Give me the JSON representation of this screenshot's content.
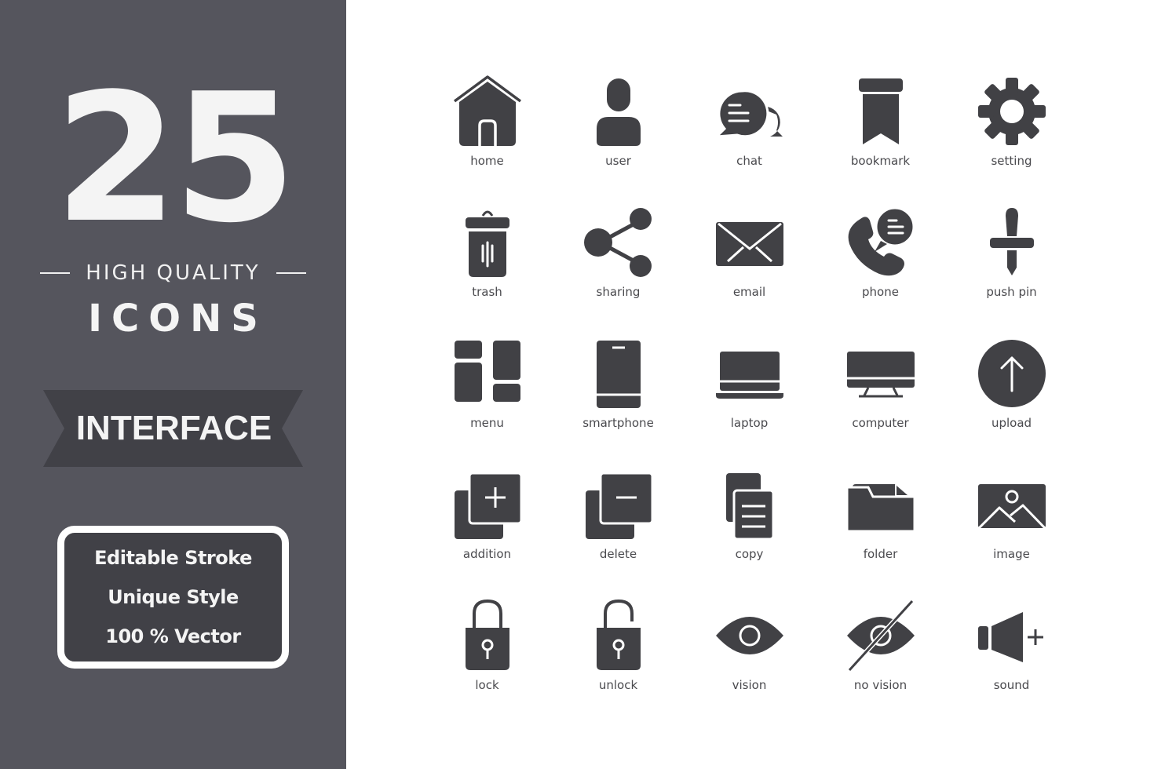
{
  "banner": {
    "count": "25",
    "subtitle": "HIGH QUALITY",
    "title": "ICONS",
    "category": "INTERFACE",
    "features": [
      "Editable Stroke",
      "Unique Style",
      "100 % Vector"
    ]
  },
  "colors": {
    "sidebar_bg": "#55555d",
    "ribbon_bg": "#414147",
    "icon_fill": "#414145",
    "text_light": "#f4f4f4",
    "label_text": "#4a4a4e"
  },
  "icons": [
    {
      "label": "home",
      "icon": "home-icon"
    },
    {
      "label": "user",
      "icon": "user-icon"
    },
    {
      "label": "chat",
      "icon": "chat-icon"
    },
    {
      "label": "bookmark",
      "icon": "bookmark-icon"
    },
    {
      "label": "setting",
      "icon": "gear-icon"
    },
    {
      "label": "trash",
      "icon": "trash-icon"
    },
    {
      "label": "sharing",
      "icon": "share-icon"
    },
    {
      "label": "email",
      "icon": "envelope-icon"
    },
    {
      "label": "phone",
      "icon": "phone-icon"
    },
    {
      "label": "push pin",
      "icon": "push-pin-icon"
    },
    {
      "label": "menu",
      "icon": "menu-icon"
    },
    {
      "label": "smartphone",
      "icon": "smartphone-icon"
    },
    {
      "label": "laptop",
      "icon": "laptop-icon"
    },
    {
      "label": "computer",
      "icon": "computer-icon"
    },
    {
      "label": "upload",
      "icon": "upload-icon"
    },
    {
      "label": "addition",
      "icon": "add-copy-icon"
    },
    {
      "label": "delete",
      "icon": "remove-copy-icon"
    },
    {
      "label": "copy",
      "icon": "copy-icon"
    },
    {
      "label": "folder",
      "icon": "folder-icon"
    },
    {
      "label": "image",
      "icon": "image-icon"
    },
    {
      "label": "lock",
      "icon": "lock-icon"
    },
    {
      "label": "unlock",
      "icon": "unlock-icon"
    },
    {
      "label": "vision",
      "icon": "eye-icon"
    },
    {
      "label": "no vision",
      "icon": "eye-off-icon"
    },
    {
      "label": "sound",
      "icon": "volume-up-icon"
    }
  ]
}
